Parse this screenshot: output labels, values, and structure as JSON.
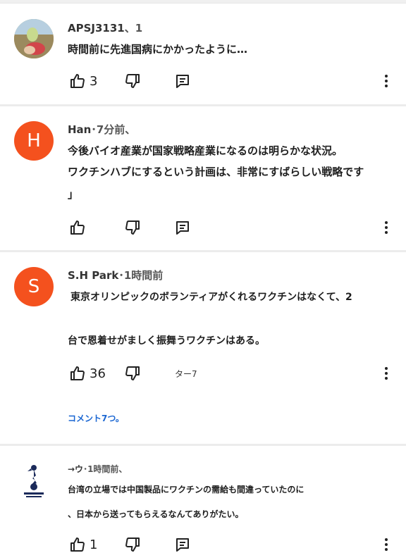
{
  "comments": [
    {
      "author": "APSJ3131",
      "meta": "、1",
      "lines": [
        "時間前に先進国病にかかったように…"
      ],
      "likes": "3"
    },
    {
      "avatar_letter": "H",
      "author": "Han",
      "meta": "･7分前、",
      "lines": [
        "今後バイオ産業が国家戦略産業になるのは明らかな状況。",
        "ワクチンハブにするという計画は、非常にすばらしい戦略です",
        "」"
      ],
      "likes": ""
    },
    {
      "avatar_letter": "S",
      "author": "S.H Park",
      "meta": "･1時間前",
      "lines": [
        "東京オリンピックのボランティアがくれるワクチンはなくて、2",
        "台で恩着せがましく振舞うワクチンはある。"
      ],
      "likes": "36",
      "garbled_text": "ター7",
      "replies_label": "コメント7つ。"
    },
    {
      "author": "→ウ",
      "meta": "･1時間前、",
      "lines": [
        "台湾の立場では中国製品にワクチンの需給も間違っていたのに",
        "、日本から送ってもらえるなんてありがたい。"
      ],
      "likes": "1"
    }
  ],
  "icons": {
    "like": "thumbs-up-icon",
    "dislike": "thumbs-down-icon",
    "reply": "reply-icon",
    "more": "more-vertical-icon"
  },
  "colors": {
    "avatar_orange": "#f4511e",
    "link_blue": "#1a66d2",
    "divider": "#ececec"
  }
}
